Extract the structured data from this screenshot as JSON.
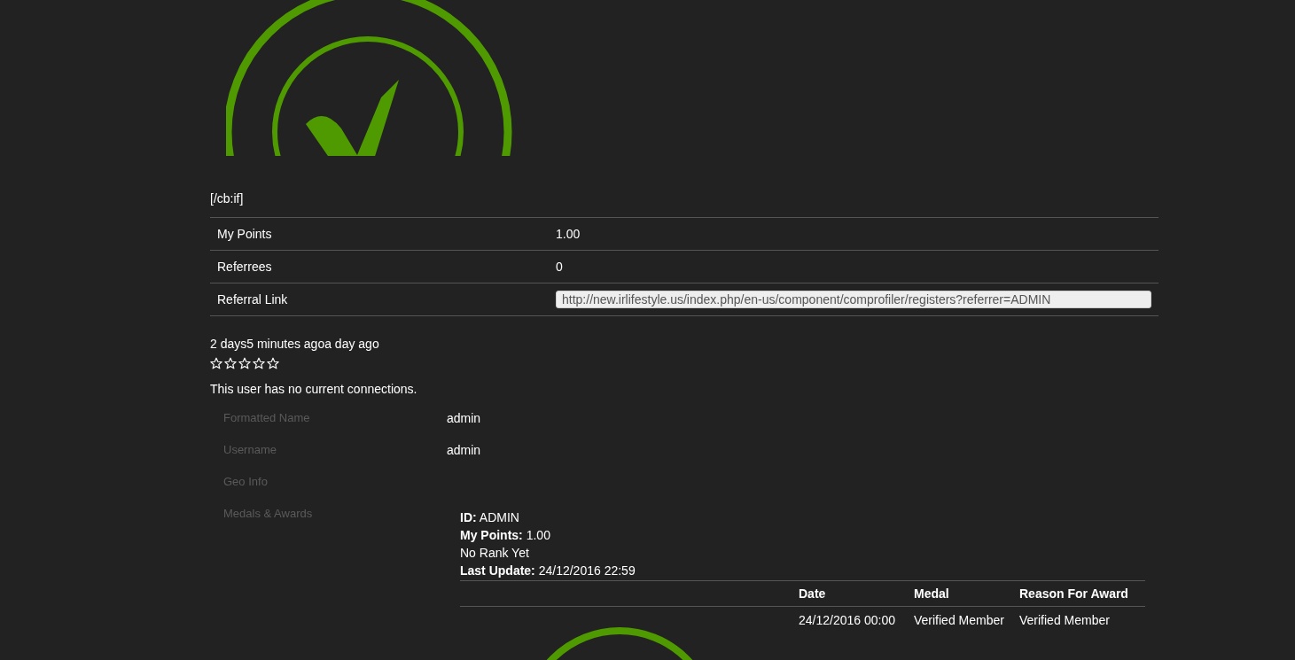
{
  "tag_text": "[/cb:if]",
  "stats": [
    {
      "label": "My Points",
      "value": "1.00",
      "kind": "text"
    },
    {
      "label": "Referrees",
      "value": "0",
      "kind": "text"
    },
    {
      "label": "Referral Link",
      "value": "http://new.irlifestyle.us/index.php/en-us/component/comprofiler/registers?referrer=ADMIN",
      "kind": "field"
    }
  ],
  "activity_text": "2 days5 minutes agoa day ago",
  "rating": {
    "stars": 0
  },
  "connections_text": "This user has no current connections.",
  "profile_fields": [
    {
      "label": "Formatted Name",
      "value": "admin"
    },
    {
      "label": "Username",
      "value": "admin"
    },
    {
      "label": "Geo Info"
    },
    {
      "label": "Medals & Awards"
    }
  ],
  "medals": {
    "lines": [
      "**ID:** ADMIN",
      "**My Points:** 1.00",
      "No Rank Yet",
      "**Last Update:** 24/12/2016 22:59"
    ],
    "columns": [
      "Date",
      "Medal",
      "Reason For Award"
    ],
    "rows": [
      [
        "24/12/2016 00:00",
        "Verified Member",
        "Verified Member"
      ]
    ]
  }
}
